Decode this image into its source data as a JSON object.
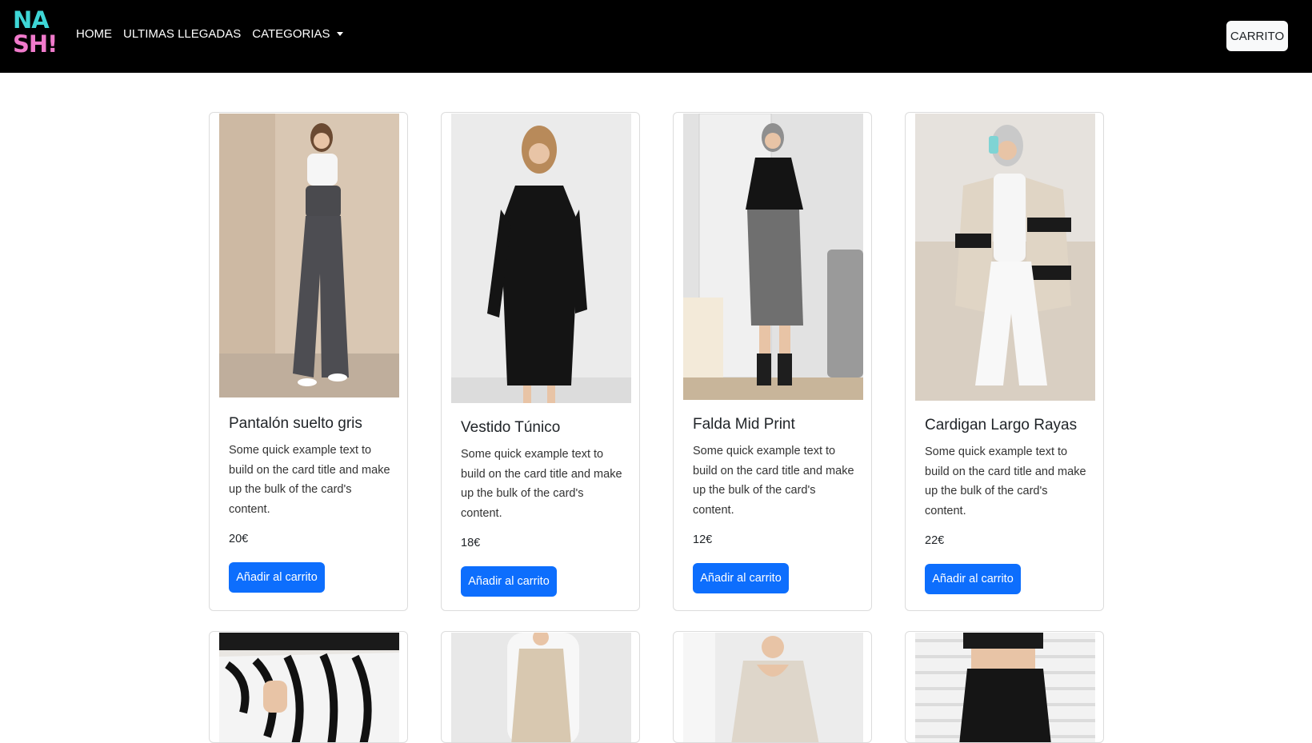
{
  "brand": {
    "line1": "NA",
    "line2": "SH!",
    "color_teal": "#3ed6d6",
    "color_pink": "#f07acb"
  },
  "nav": {
    "links": [
      "HOME",
      "ULTIMAS LLEGADAS",
      "CATEGORIAS"
    ],
    "cart_label": "CARRITO"
  },
  "colors": {
    "navbar_bg": "#000000",
    "primary": "#0d6efd"
  },
  "products": [
    {
      "title": "Pantalón suelto gris",
      "text": "Some quick example text to build on the card title and make up the bulk of the card's content.",
      "price": "20€",
      "button": "Añadir al carrito"
    },
    {
      "title": "Vestido Túnico",
      "text": "Some quick example text to build on the card title and make up the bulk of the card's content.",
      "price": "18€",
      "button": "Añadir al carrito"
    },
    {
      "title": "Falda Mid Print",
      "text": "Some quick example text to build on the card title and make up the bulk of the card's content.",
      "price": "12€",
      "button": "Añadir al carrito"
    },
    {
      "title": "Cardigan Largo Rayas",
      "text": "Some quick example text to build on the card title and make up the bulk of the card's content.",
      "price": "22€",
      "button": "Añadir al carrito"
    }
  ]
}
